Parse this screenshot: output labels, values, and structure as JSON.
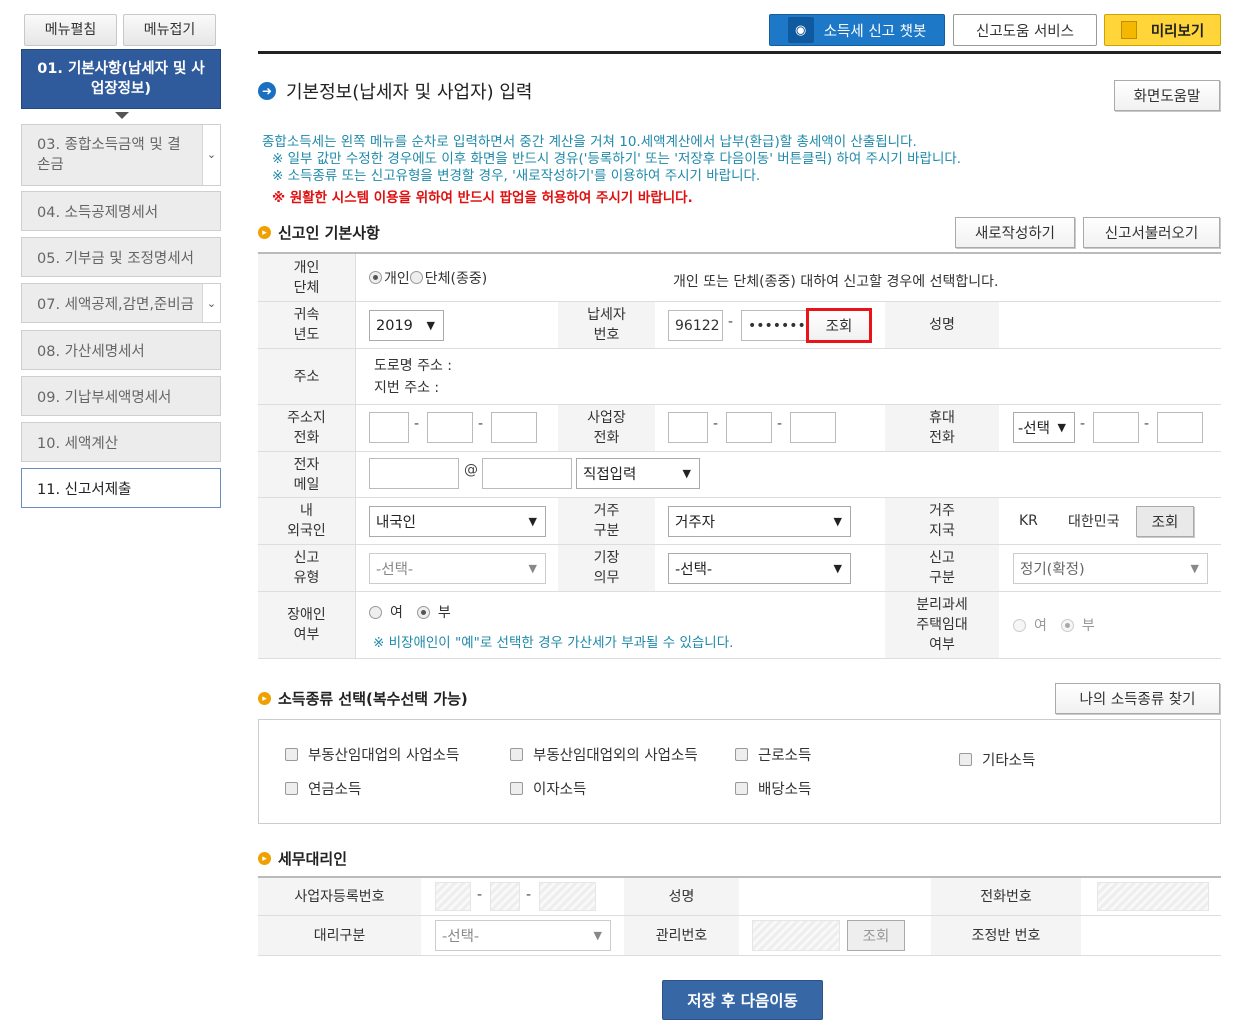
{
  "sidebar": {
    "expand": "메뉴펼침",
    "collapse": "메뉴접기",
    "items": [
      {
        "label": "01. 기본사항(납세자 및 사업장정보)"
      },
      {
        "label": "03. 종합소득금액 및 결손금"
      },
      {
        "label": "04. 소득공제명세서"
      },
      {
        "label": "05. 기부금 및 조정명세서"
      },
      {
        "label": "07. 세액공제,감면,준비금"
      },
      {
        "label": "08. 가산세명세서"
      },
      {
        "label": "09. 기납부세액명세서"
      },
      {
        "label": "10. 세액계산"
      },
      {
        "label": "11. 신고서제출"
      }
    ]
  },
  "topbar": {
    "chatbot": "소득세 신고 챗봇",
    "help_service": "신고도움 서비스",
    "preview": "미리보기"
  },
  "page": {
    "title": "기본정보(납세자 및 사업자) 입력",
    "screen_help": "화면도움말",
    "notice1": "종합소득세는 왼쪽 메뉴를 순차로 입력하면서 중간 계산을 거쳐 10.세액계산에서 납부(환급)할 총세액이 산출됩니다.",
    "notice2": "※ 일부 값만 수정한 경우에도 이후 화면을 반드시 경유('등록하기' 또는 '저장후 다음이동' 버튼클릭) 하여 주시기 바랍니다.",
    "notice3": "※ 소득종류 또는 신고유형을 변경할 경우, '새로작성하기'를 이용하여 주시기 바랍니다.",
    "notice4": "※ 원활한 시스템 이용을 위하여 반드시 팝업을 허용하여 주시기 바랍니다."
  },
  "basic": {
    "section": "신고인 기본사항",
    "new_btn": "새로작성하기",
    "load_btn": "신고서불러오기",
    "type_label": "개인\n단체",
    "opt_individual": "개인",
    "opt_group": "단체(종중)",
    "type_desc": "개인 또는 단체(종중) 대하여 신고할 경우에 선택합니다.",
    "year_label": "귀속\n년도",
    "year_value": "2019",
    "taxpayer_no_label": "납세자\n번호",
    "taxpayer_no_1": "96122",
    "taxpayer_no_2": "•••••••",
    "lookup": "조회",
    "name_label": "성명",
    "address_label": "주소",
    "road_addr": "도로명 주소 :",
    "lot_addr": "지번 주소 :",
    "home_phone_label": "주소지\n전화",
    "biz_phone_label": "사업장\n전화",
    "mobile_label": "휴대\n전화",
    "mobile_select": "-선택",
    "email_label": "전자\n메일",
    "at": "@",
    "email_domain": "직접입력",
    "nationality_label": "내\n외국인",
    "nationality_value": "내국인",
    "residence_label": "거주\n구분",
    "residence_value": "거주자",
    "residence_country_label": "거주\n지국",
    "country_code": "KR",
    "country_name": "대한민국",
    "filing_type_label": "신고\n유형",
    "filing_type_value": "-선택-",
    "bookkeeping_label": "기장\n의무",
    "bookkeeping_value": "-선택-",
    "filing_class_label": "신고\n구분",
    "filing_class_value": "정기(확정)",
    "disabled_label": "장애인\n여부",
    "yes": "여",
    "no": "부",
    "disabled_note": "※ 비장애인이 \"예\"로 선택한 경우 가산세가 부과될 수 있습니다.",
    "rental_label": "분리과세\n주택임대\n여부"
  },
  "income": {
    "section": "소득종류 선택(복수선택 가능)",
    "find_btn": "나의 소득종류 찾기",
    "items": [
      "부동산임대업의 사업소득",
      "부동산임대업외의 사업소득",
      "근로소득",
      "기타소득",
      "연금소득",
      "이자소득",
      "배당소득"
    ]
  },
  "agent": {
    "section": "세무대리인",
    "biz_no_label": "사업자등록번호",
    "name_label": "성명",
    "phone_label": "전화번호",
    "agent_type_label": "대리구분",
    "agent_type_value": "-선택-",
    "manage_no_label": "관리번호",
    "lookup": "조회",
    "team_no_label": "조정반 번호"
  },
  "footer": {
    "save_next": "저장 후 다음이동"
  },
  "colors": {
    "accent_blue": "#2f5a9b",
    "chatbot_blue": "#1d78c8",
    "preview_yellow": "#ffd53a",
    "notice_teal": "#1f8aa9",
    "warning_red": "#e01010",
    "highlight_red": "#e8141a"
  }
}
